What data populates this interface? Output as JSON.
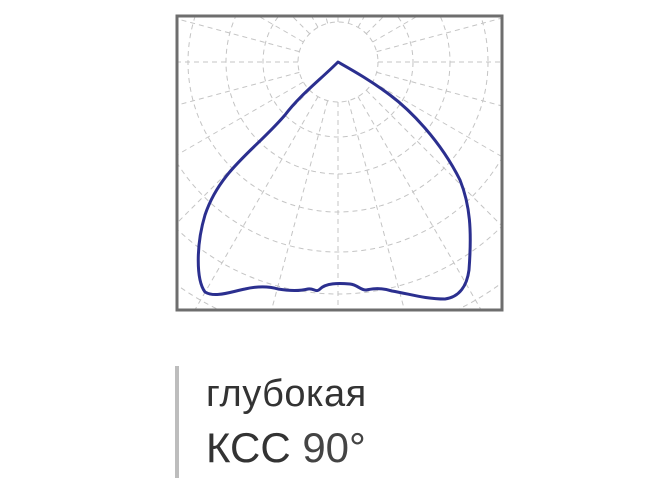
{
  "caption": {
    "line1": "глубокая",
    "line2_prefix": "КСС",
    "line2_angle": "90°"
  },
  "colors": {
    "curve": "#2b2f8f",
    "frame": "#6e6e6e",
    "grid": "#c4c4c4",
    "text": "#333333",
    "accent_bar": "#bdbdbd"
  }
}
